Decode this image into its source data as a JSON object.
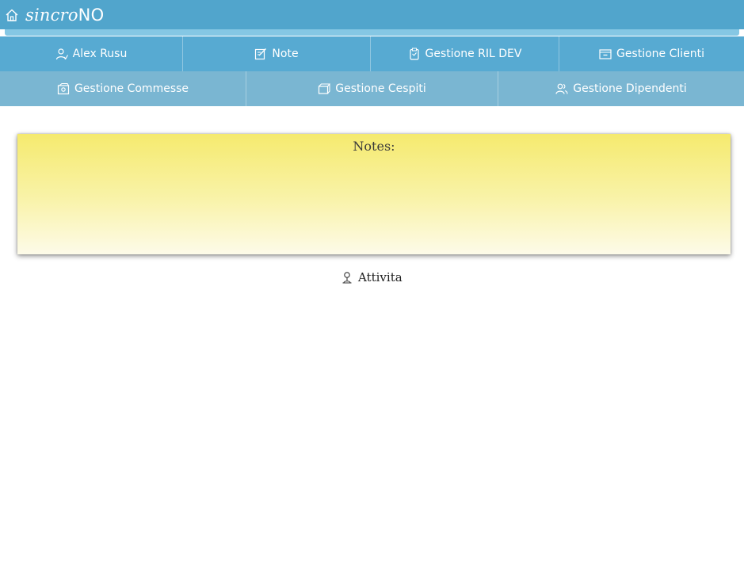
{
  "brand": {
    "lower": "sincro",
    "upper": "NO",
    "icon": "home-icon"
  },
  "nav": {
    "row1": [
      {
        "label": "Alex Rusu",
        "icon": "user-icon"
      },
      {
        "label": "Note",
        "icon": "edit-note-icon"
      },
      {
        "label": "Gestione RIL DEV",
        "icon": "clipboard-icon"
      },
      {
        "label": "Gestione Clienti",
        "icon": "folder-minus-icon"
      }
    ],
    "row2": [
      {
        "label": "Gestione Commesse",
        "icon": "orders-icon"
      },
      {
        "label": "Gestione Cespiti",
        "icon": "box-icon"
      },
      {
        "label": "Gestione Dipendenti",
        "icon": "group-icon"
      }
    ]
  },
  "notes": {
    "title": "Notes:"
  },
  "attivita": {
    "label": "Attivita",
    "icon": "user-pin-icon"
  },
  "colors": {
    "topbar": "#51a5cc",
    "nav_row1": "#57aad2",
    "nav_row2": "#7ab6d2",
    "notes_bg": "#f5ea6e"
  }
}
